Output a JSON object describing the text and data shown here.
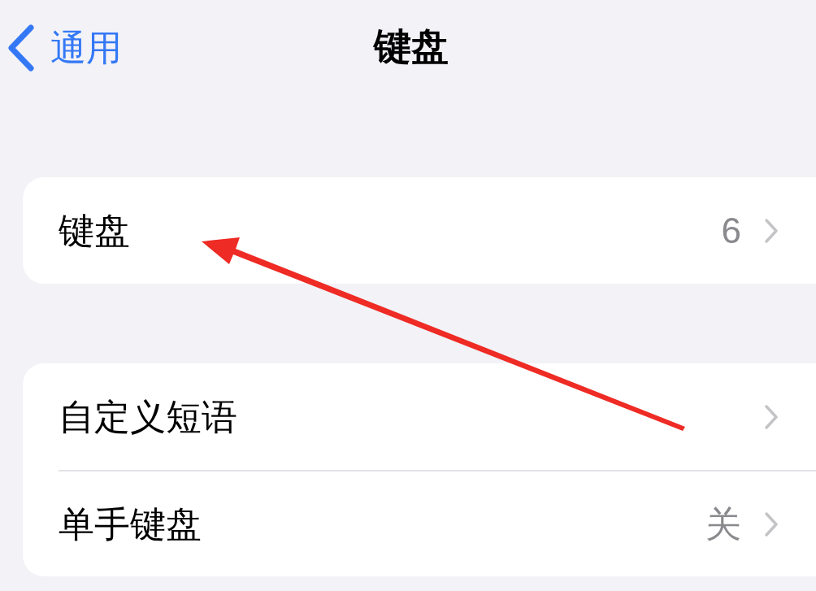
{
  "nav": {
    "back_label": "通用",
    "title": "键盘"
  },
  "groups": [
    {
      "rows": [
        {
          "label": "键盘",
          "value": "6"
        }
      ]
    },
    {
      "rows": [
        {
          "label": "自定义短语"
        },
        {
          "label": "单手键盘",
          "value": "关"
        }
      ]
    }
  ]
}
